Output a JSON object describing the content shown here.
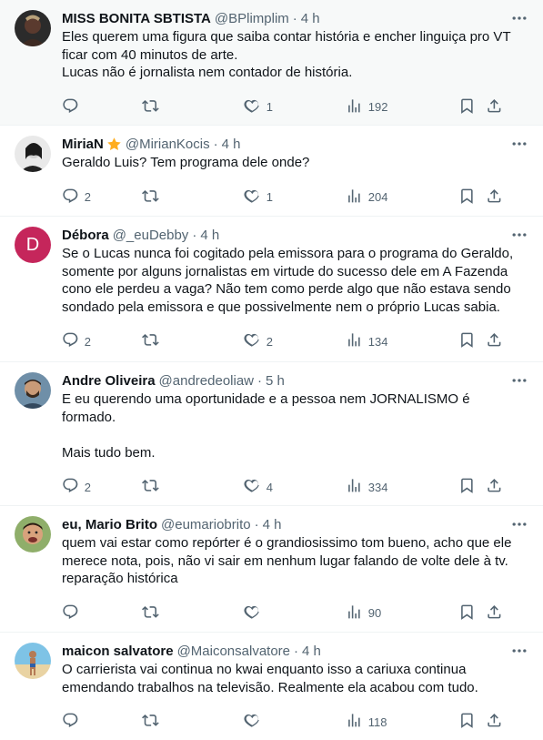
{
  "tweets": [
    {
      "name": "MISS BONITA SBTISTA",
      "handle": "@BPlimplim",
      "time": "4 h",
      "text": "Eles querem uma figura que saiba contar história e encher linguiça pro VT\nficar com 40 minutos de arte.\nLucas não é jornalista nem contador de história.",
      "replies": "",
      "retweets": "",
      "likes": "1",
      "views": "192"
    },
    {
      "name": "MiriaN",
      "handle": "@MirianKocis",
      "time": "4 h",
      "text": "Geraldo Luis? Tem programa dele onde?",
      "replies": "2",
      "retweets": "",
      "likes": "1",
      "views": "204"
    },
    {
      "name": "Débora",
      "avatar_letter": "D",
      "handle": "@_euDebby",
      "time": "4 h",
      "text": "Se o Lucas nunca foi cogitado pela emissora para o programa do Geraldo,\nsomente por alguns jornalistas em virtude do sucesso dele em A Fazenda\ncono ele perdeu a vaga? Não tem como perde algo que não estava sendo\nsondado pela emissora e que possivelmente nem o próprio Lucas sabia.",
      "replies": "2",
      "retweets": "",
      "likes": "2",
      "views": "134"
    },
    {
      "name": "Andre Oliveira",
      "handle": "@andredeoliaw",
      "time": "5 h",
      "text": "E eu querendo uma oportunidade e a pessoa nem JORNALISMO é\nformado.\n\nMais tudo bem.",
      "replies": "2",
      "retweets": "",
      "likes": "4",
      "views": "334"
    },
    {
      "name": "eu, Mario Brito",
      "handle": "@eumariobrito",
      "time": "4 h",
      "text": "quem vai estar como repórter é o grandiosissimo tom bueno, acho que ele\nmerece nota, pois, não vi sair em nenhum lugar falando de volte dele à tv.\nreparação histórica",
      "replies": "",
      "retweets": "",
      "likes": "",
      "views": "90"
    },
    {
      "name": "maicon salvatore",
      "handle": "@Maiconsalvatore",
      "time": "4 h",
      "text": "O carrierista vai continua no kwai enquanto isso a cariuxa continua\nemendando trabalhos na televisão. Realmente ela acabou com tudo.",
      "replies": "",
      "retweets": "",
      "likes": "",
      "views": "118"
    }
  ],
  "dot": "·",
  "colors": {
    "text": "#0f1419",
    "secondary": "#536471",
    "highlight_bg": "#f7f9f9",
    "divider": "#eff3f4",
    "debora_avatar": "#c5265b",
    "badge": "#ffad1f"
  }
}
